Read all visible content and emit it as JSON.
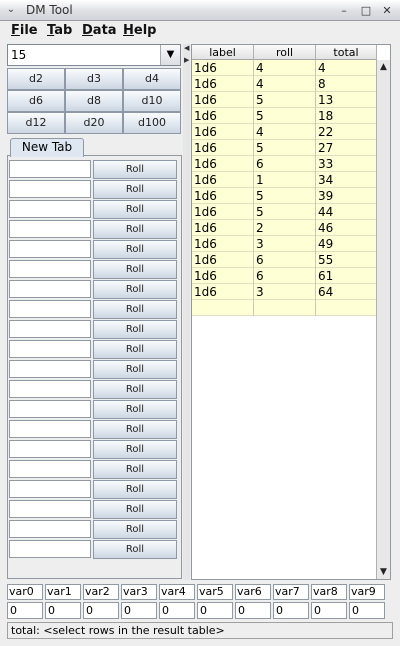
{
  "window": {
    "title": "DM Tool",
    "menu_icon": "⌄",
    "minimize_icon": "–",
    "maximize_icon": "□",
    "close_icon": "✕"
  },
  "menubar": {
    "items": [
      {
        "label": "File",
        "mnemonic": "F",
        "rest": "ile"
      },
      {
        "label": "Tab",
        "mnemonic": "T",
        "rest": "ab"
      },
      {
        "label": "Data",
        "mnemonic": "D",
        "rest": "ata"
      },
      {
        "label": "Help",
        "mnemonic": "H",
        "rest": "elp"
      }
    ]
  },
  "dice": {
    "selected_count": "15",
    "buttons": [
      "d2",
      "d3",
      "d4",
      "d6",
      "d8",
      "d10",
      "d12",
      "d20",
      "d100"
    ]
  },
  "tabs": {
    "active": "New Tab"
  },
  "roll_rows": {
    "button_label": "Roll",
    "count": 20
  },
  "results": {
    "columns": [
      "label",
      "roll",
      "total"
    ],
    "rows": [
      [
        "1d6",
        "4",
        "4"
      ],
      [
        "1d6",
        "4",
        "8"
      ],
      [
        "1d6",
        "5",
        "13"
      ],
      [
        "1d6",
        "5",
        "18"
      ],
      [
        "1d6",
        "4",
        "22"
      ],
      [
        "1d6",
        "5",
        "27"
      ],
      [
        "1d6",
        "6",
        "33"
      ],
      [
        "1d6",
        "1",
        "34"
      ],
      [
        "1d6",
        "5",
        "39"
      ],
      [
        "1d6",
        "5",
        "44"
      ],
      [
        "1d6",
        "2",
        "46"
      ],
      [
        "1d6",
        "3",
        "49"
      ],
      [
        "1d6",
        "6",
        "55"
      ],
      [
        "1d6",
        "6",
        "61"
      ],
      [
        "1d6",
        "3",
        "64"
      ],
      [
        "",
        "",
        ""
      ]
    ]
  },
  "variables": {
    "names": [
      "var0",
      "var1",
      "var2",
      "var3",
      "var4",
      "var5",
      "var6",
      "var7",
      "var8",
      "var9"
    ],
    "values": [
      "0",
      "0",
      "0",
      "0",
      "0",
      "0",
      "0",
      "0",
      "0",
      "0"
    ]
  },
  "status": {
    "text": "total: <select rows in the result table>"
  }
}
